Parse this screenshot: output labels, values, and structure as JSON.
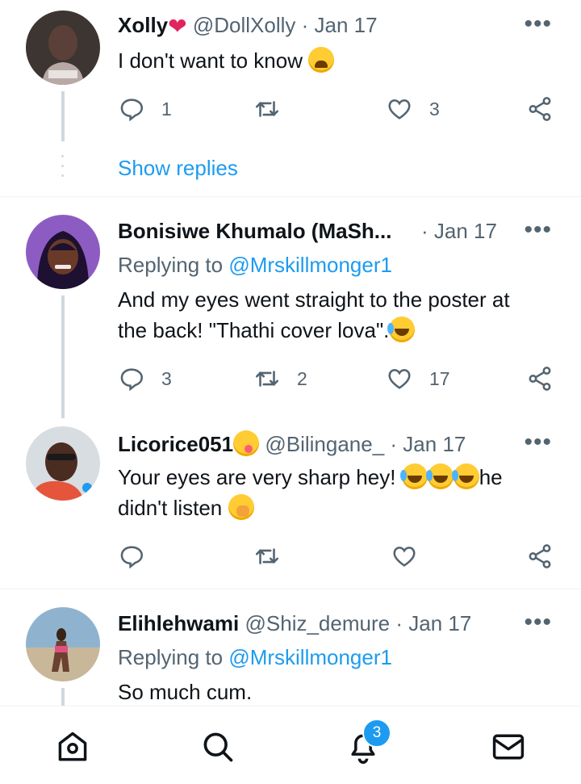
{
  "tweets": [
    {
      "name": "Xolly",
      "handle": "@DollXolly",
      "sep": "·",
      "date": "Jan 17",
      "text": "I don't want to know",
      "replies": "1",
      "retweets": "",
      "likes": "3",
      "show_replies": "Show replies"
    },
    {
      "name": "Bonisiwe Khumalo (MaSh...",
      "sep": "·",
      "date": "Jan 17",
      "replying_label": "Replying to",
      "replying_to": "@Mrskillmonger1",
      "text_line1": "And my eyes went straight to the poster at",
      "text_line2": "the back! \"Thathi cover lova\".",
      "replies": "3",
      "retweets": "2",
      "likes": "17"
    },
    {
      "name": "Licorice051",
      "handle": "@Bilingane_",
      "sep": "·",
      "date": "Jan 17",
      "text_line1": "Your eyes are very sharp hey!",
      "text_line1_end": "he",
      "text_line2": "didn't listen",
      "replies": "",
      "retweets": "",
      "likes": ""
    },
    {
      "name": "Elihlehwami",
      "handle": "@Shiz_demure",
      "sep": "·",
      "date": "Jan 17",
      "replying_label": "Replying to",
      "replying_to": "@Mrskillmonger1",
      "text": "So much cum."
    }
  ],
  "more_glyph": "•••",
  "nav": {
    "items": [
      "home-icon",
      "search-icon",
      "notifications-icon",
      "messages-icon"
    ],
    "notification_count": "3"
  },
  "colors": {
    "accent": "#1d9bf0",
    "muted": "#536471",
    "thread_line": "#cfd9de",
    "heart": "#e0245e"
  }
}
